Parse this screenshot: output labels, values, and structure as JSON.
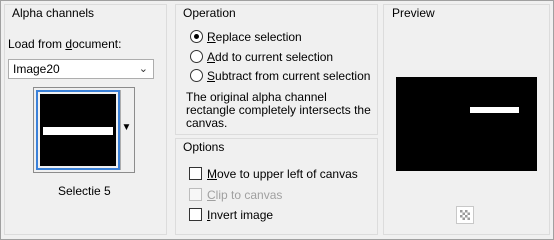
{
  "alpha_panel": {
    "title": "Alpha channels",
    "load_label_pre": "Load from ",
    "load_label_u": "d",
    "load_label_post": "ocument:",
    "document_selected": "Image20",
    "selection_name": "Selectie 5"
  },
  "operation_panel": {
    "title": "Operation",
    "options": [
      {
        "u": "R",
        "rest": "eplace selection",
        "checked": true
      },
      {
        "u": "A",
        "rest": "dd to current selection",
        "checked": false
      },
      {
        "u": "S",
        "rest": "ubtract from current selection",
        "checked": false
      }
    ],
    "info_lines": [
      "The original alpha channel",
      "rectangle completely intersects the",
      "canvas."
    ]
  },
  "options_panel": {
    "title": "Options",
    "move": {
      "u": "M",
      "rest": "ove to upper left of canvas",
      "checked": false
    },
    "clip": {
      "u": "C",
      "rest": "lip to canvas",
      "checked": false,
      "disabled": true
    },
    "invert": {
      "u": "I",
      "rest": "nvert image",
      "checked": false
    }
  },
  "preview_panel": {
    "title": "Preview",
    "zoom_icon": "checkerboard-icon"
  },
  "colors": {
    "selection_highlight": "#3a80d8",
    "canvas": "#000000",
    "channel": "#ffffff"
  }
}
